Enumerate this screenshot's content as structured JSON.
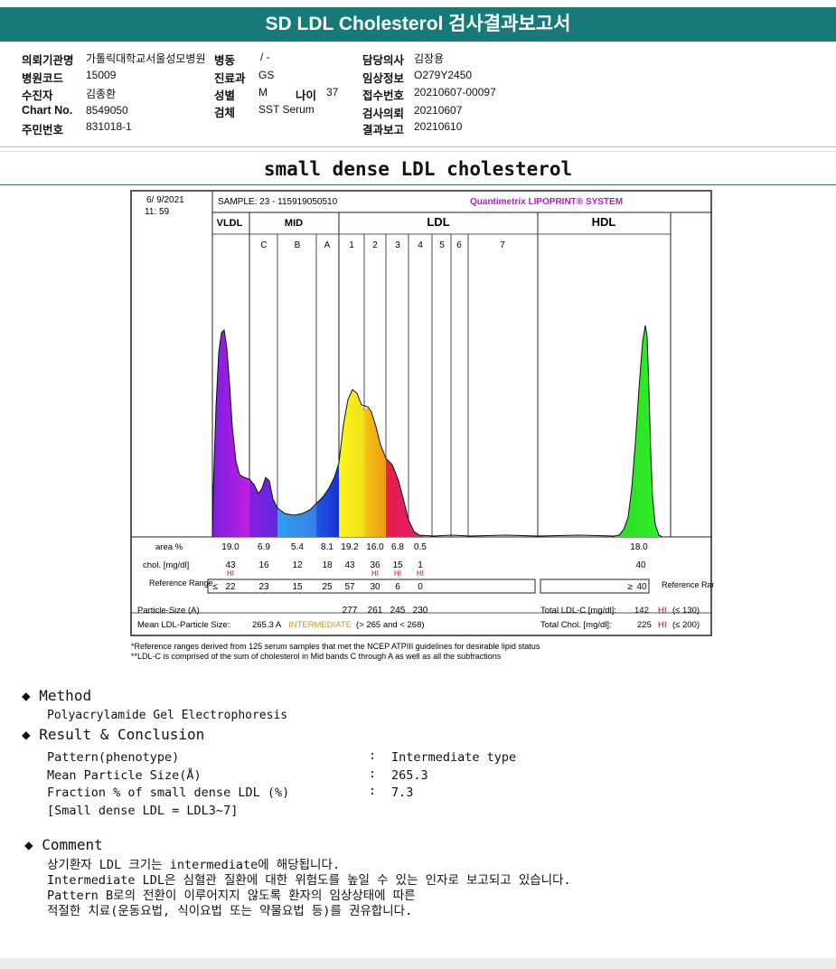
{
  "header": {
    "title": "SD LDL Cholesterol 검사결과보고서"
  },
  "patient": {
    "col1": [
      {
        "label": "의뢰기관명",
        "value": "가톨릭대학교서울성모병원"
      },
      {
        "label": "병원코드",
        "value": "15009"
      },
      {
        "label": "수진자",
        "value": "김종환"
      },
      {
        "label": "Chart No.",
        "value": "8549050"
      },
      {
        "label": "주민번호",
        "value": "831018-1"
      }
    ],
    "col2": [
      {
        "label": "병동",
        "value": "/ -"
      },
      {
        "label": "진료과",
        "value": "GS"
      },
      {
        "label": "성별",
        "value": "M"
      },
      {
        "label": "검체",
        "value": "SST Serum"
      }
    ],
    "age": {
      "label": "나이",
      "value": "37"
    },
    "col3": [
      {
        "label": "담당의사",
        "value": "김장용"
      },
      {
        "label": "임상정보",
        "value": "O279Y2450"
      },
      {
        "label": "접수번호",
        "value": "20210607-00097"
      },
      {
        "label": "검사의뢰",
        "value": "20210607"
      },
      {
        "label": "결과보고",
        "value": "20210610"
      }
    ]
  },
  "section_title": "small dense LDL cholesterol",
  "chart_data": {
    "type": "area",
    "date": "6/ 9/2021",
    "time": "11: 59",
    "sample": "SAMPLE:   23 - 115919050510",
    "brand": "Quantimetrix LIPOPRINT® SYSTEM",
    "groups": [
      "VLDL",
      "MID",
      "LDL",
      "HDL"
    ],
    "bands": [
      "C",
      "B",
      "A",
      "1",
      "2",
      "3",
      "4",
      "5",
      "6",
      "7"
    ],
    "row_labels": {
      "area": "area %",
      "chol": "chol. [mg/dl]",
      "ref": "Reference Range",
      "size": "Particle-Size (A)",
      "mean": "Mean LDL-Particle Size:"
    },
    "area_pct": [
      "19.0",
      "6.9",
      "5.4",
      "8.1",
      "19.2",
      "16.0",
      "6.8",
      "0.5",
      "18.0"
    ],
    "chol": [
      "43",
      "16",
      "12",
      "18",
      "43",
      "36",
      "15",
      "1",
      "40"
    ],
    "hi_flags": [
      true,
      false,
      false,
      false,
      false,
      true,
      true,
      true,
      false
    ],
    "hi_text": "HI",
    "reference": {
      "vldl_op": "≤",
      "values": [
        "22",
        "23",
        "15",
        "25",
        "57",
        "30",
        "6",
        "0"
      ],
      "hdl_op": "≥",
      "hdl": "40",
      "side_label": "Reference Range"
    },
    "particle_size": [
      "277",
      "261",
      "245",
      "230"
    ],
    "mean_size": {
      "value": "265.3 A",
      "category": "INTERMEDIATE",
      "range": "(> 265 and < 268)"
    },
    "total_ldl": {
      "label": "Total LDL-C [mg/dl]:",
      "value": "142",
      "flag": "HI",
      "ref": "(≤ 130)"
    },
    "total_chol": {
      "label": "Total Chol. [mg/dl]:",
      "value": "225",
      "flag": "HI",
      "ref": "(≤ 200)"
    },
    "footnote1": "*Reference ranges derived from 125 serum samples that met the NCEP ATPIII guidelines for desirable lipid status",
    "footnote2": "**LDL-C is comprised of the sum of cholesterol in Mid bands C through A as well as all the subfractions",
    "colors": {
      "vldl": "#a51de0",
      "midC": "#6f1de0",
      "midB": "#2f8be8",
      "midA": "#1b3fe0",
      "ldl1": "#f6f21a",
      "ldl2": "#f6b514",
      "ldl3": "#e11d4d",
      "hdl": "#24e31f",
      "brand": "#b71cc7",
      "hi": "#cc0000"
    }
  },
  "method": {
    "title": "Method",
    "text": "Polyacrylamide Gel Electrophoresis"
  },
  "result": {
    "title": "Result & Conclusion",
    "rows": [
      {
        "label": "Pattern(phenotype)",
        "value": "Intermediate type"
      },
      {
        "label": "Mean Particle Size(Å)",
        "value": "265.3"
      },
      {
        "label": "Fraction % of small dense LDL (%)",
        "value": "7.3"
      }
    ],
    "colon": ":",
    "note": "[Small dense LDL = LDL3~7]"
  },
  "comment": {
    "title": "Comment",
    "lines": [
      "상기환자 LDL 크기는 intermediate에 해당됩니다.",
      "Intermediate LDL은 심혈관 질환에 대한 위험도를 높일 수 있는 인자로 보고되고 있습니다.",
      "Pattern B로의 전환이 이루어지지 않도록 환자의 임상상태에 따른",
      "적절한 치료(운동요법, 식이요법 또는 약물요법 등)를 권유합니다."
    ]
  }
}
